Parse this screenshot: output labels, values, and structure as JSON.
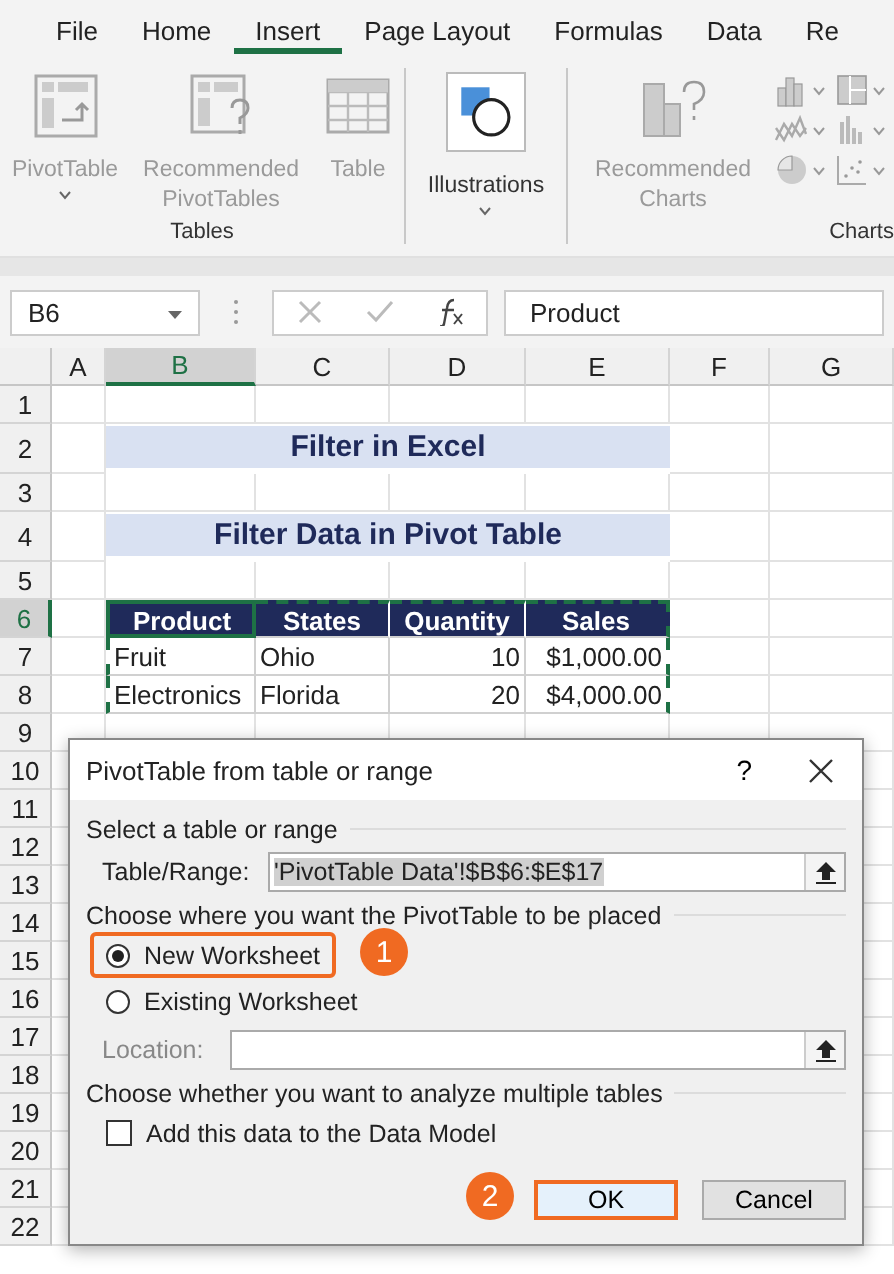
{
  "ribbon_tabs": [
    {
      "label": "File",
      "selected": false
    },
    {
      "label": "Home",
      "selected": false
    },
    {
      "label": "Insert",
      "selected": true
    },
    {
      "label": "Page Layout",
      "selected": false
    },
    {
      "label": "Formulas",
      "selected": false
    },
    {
      "label": "Data",
      "selected": false
    },
    {
      "label": "Re",
      "selected": false
    }
  ],
  "ribbon_groups": [
    {
      "kind": "tables",
      "label": "Tables",
      "buttons": [
        {
          "kind": "pivot",
          "label": "PivotTable",
          "disabled": true,
          "dropdown": true
        },
        {
          "kind": "recpivot",
          "label": "Recommended PivotTables",
          "disabled": true,
          "dropdown": false
        },
        {
          "kind": "table",
          "label": "Table",
          "disabled": true,
          "dropdown": false
        }
      ]
    },
    {
      "kind": "illustrations",
      "buttons": [
        {
          "kind": "illustrations",
          "label": "Illustrations",
          "disabled": false,
          "dropdown": true
        }
      ]
    },
    {
      "kind": "charts",
      "label": "Charts",
      "buttons": [
        {
          "kind": "recchart",
          "label": "Recommended Charts",
          "disabled": true,
          "dropdown": false
        }
      ]
    }
  ],
  "formula_bar": {
    "name_box": "B6",
    "formula": "Product"
  },
  "sheet": {
    "columns": [
      {
        "label": "A",
        "selected": false
      },
      {
        "label": "B",
        "selected": true
      },
      {
        "label": "C",
        "selected": false
      },
      {
        "label": "D",
        "selected": false
      },
      {
        "label": "E",
        "selected": false
      },
      {
        "label": "F",
        "selected": false
      },
      {
        "label": "G",
        "selected": false
      }
    ],
    "rows": [
      {
        "number": "1",
        "kind": "blank",
        "selected": false
      },
      {
        "number": "2",
        "kind": "title",
        "selected": false,
        "text": "Filter in Excel"
      },
      {
        "number": "3",
        "kind": "blank",
        "selected": false
      },
      {
        "number": "4",
        "kind": "title",
        "selected": false,
        "text": "Filter Data in Pivot Table"
      },
      {
        "number": "5",
        "kind": "blank",
        "selected": false
      },
      {
        "number": "6",
        "kind": "header",
        "selected": true,
        "cells": [
          "Product",
          "States",
          "Quantity",
          "Sales"
        ]
      },
      {
        "number": "7",
        "kind": "data",
        "selected": false,
        "cells": [
          "Fruit",
          "Ohio",
          "10",
          "$1,000.00"
        ]
      },
      {
        "number": "8",
        "kind": "data",
        "selected": false,
        "cells": [
          "Electronics",
          "Florida",
          "20",
          "$4,000.00"
        ]
      },
      {
        "number": "9",
        "kind": "blank",
        "selected": false
      },
      {
        "number": "10",
        "kind": "blank",
        "selected": false
      },
      {
        "number": "11",
        "kind": "blank",
        "selected": false
      },
      {
        "number": "12",
        "kind": "blank",
        "selected": false
      },
      {
        "number": "13",
        "kind": "blank",
        "selected": false
      },
      {
        "number": "14",
        "kind": "blank",
        "selected": false
      },
      {
        "number": "15",
        "kind": "blank",
        "selected": false
      },
      {
        "number": "16",
        "kind": "blank",
        "selected": false
      },
      {
        "number": "17",
        "kind": "blank",
        "selected": false
      },
      {
        "number": "18",
        "kind": "blank",
        "selected": false
      },
      {
        "number": "19",
        "kind": "blank",
        "selected": false
      },
      {
        "number": "20",
        "kind": "blank",
        "selected": false
      },
      {
        "number": "21",
        "kind": "blank",
        "selected": false
      },
      {
        "number": "22",
        "kind": "blank",
        "selected": false
      }
    ]
  },
  "dialog": {
    "title": "PivotTable from table or range",
    "help": "?",
    "source": {
      "heading": "Select a table or range",
      "label": "Table/Range:",
      "value": "'PivotTable Data'!$B$6:$E$17"
    },
    "placement": {
      "heading": "Choose where you want the PivotTable to be placed",
      "options": [
        {
          "label": "New Worksheet",
          "selected": true,
          "highlighted": true,
          "callout": "1"
        },
        {
          "label": "Existing Worksheet",
          "selected": false,
          "highlighted": false
        }
      ],
      "location_label": "Location:",
      "location_disabled": true
    },
    "data_model": {
      "heading": "Choose whether you want to analyze multiple tables",
      "label": "Add this data to the Data Model",
      "checked": false
    },
    "buttons": [
      {
        "label": "OK",
        "highlighted": true,
        "callout": "2"
      },
      {
        "label": "Cancel",
        "highlighted": false
      }
    ]
  }
}
